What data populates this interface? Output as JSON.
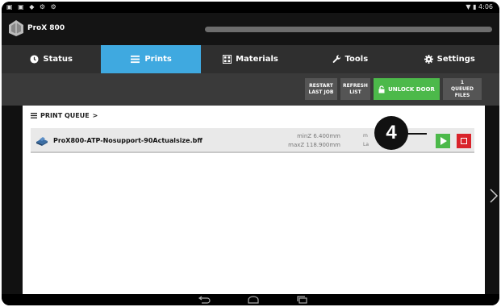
{
  "status_bar": {
    "left_icons": "▣ ▣ ◆ ⚙ ⚙",
    "right_text": "▼ ▮ 4:06"
  },
  "app": {
    "title": "ProX 800",
    "progress_percent": 100
  },
  "tabs": [
    {
      "label": "Status",
      "icon": "clock-icon",
      "active": false
    },
    {
      "label": "Prints",
      "icon": "list-icon",
      "active": true
    },
    {
      "label": "Materials",
      "icon": "materials-icon",
      "active": false
    },
    {
      "label": "Tools",
      "icon": "wrench-icon",
      "active": false
    },
    {
      "label": "Settings",
      "icon": "gear-icon",
      "active": false
    }
  ],
  "toolbar": {
    "restart_line1": "RESTART",
    "restart_line2": "LAST JOB",
    "refresh_line1": "REFRESH",
    "refresh_line2": "LIST",
    "unlock_label": "UNLOCK DOOR",
    "queue_count": "1",
    "queue_label": "QUEUED FILES"
  },
  "queue": {
    "header": "PRINT QUEUE",
    "header_chevron": ">",
    "items": [
      {
        "file_name": "ProX800-ATP-Nosupport-90Actualsize.bff",
        "minz": "minZ 6.400mm",
        "maxz": "maxZ 118.900mm",
        "trunc1": "m",
        "trunc2": "La"
      }
    ]
  },
  "callout": {
    "number": "4"
  },
  "colors": {
    "accent_blue": "#3fa9e0",
    "green": "#4cb94a",
    "red": "#d9242b"
  }
}
